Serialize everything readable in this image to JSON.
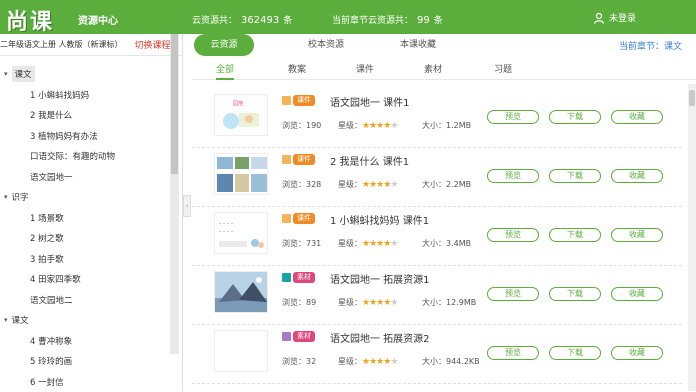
{
  "header": {
    "logo": "尚课",
    "section": "资源中心",
    "cloud_label": "云资源共：",
    "cloud_count": "362493",
    "cloud_unit": "条",
    "chapter_label": "当前章节云资源共：",
    "chapter_count": "99",
    "chapter_unit": "条",
    "login": "未登录"
  },
  "sidebar": {
    "book": "二年级语文上册 人教版（新课标）",
    "switch": "切换课程>",
    "tree": [
      {
        "label": "课文",
        "type": "unit",
        "active": true
      },
      {
        "label": "1 小蝌蚪找妈妈",
        "type": "lesson"
      },
      {
        "label": "2 我是什么",
        "type": "lesson"
      },
      {
        "label": "3 植物妈妈有办法",
        "type": "lesson"
      },
      {
        "label": "口语交际：有趣的动物",
        "type": "lesson"
      },
      {
        "label": "语文园地一",
        "type": "lesson"
      },
      {
        "label": "识字",
        "type": "unit"
      },
      {
        "label": "1 场景歌",
        "type": "lesson"
      },
      {
        "label": "2 树之歌",
        "type": "lesson"
      },
      {
        "label": "3 拍手歌",
        "type": "lesson"
      },
      {
        "label": "4 田家四季歌",
        "type": "lesson"
      },
      {
        "label": "语文园地二",
        "type": "lesson"
      },
      {
        "label": "课文",
        "type": "unit"
      },
      {
        "label": "4 曹冲称象",
        "type": "lesson"
      },
      {
        "label": "5 玲玲的画",
        "type": "lesson"
      },
      {
        "label": "6 一封信",
        "type": "lesson"
      }
    ]
  },
  "tabs": [
    "云资源",
    "校本资源",
    "本课收藏"
  ],
  "current_chapter": "当前章节：课文",
  "subtabs": [
    "全部",
    "教案",
    "课件",
    "素材",
    "习题"
  ],
  "labels": {
    "views": "浏览：",
    "rating": "星级：",
    "size": "大小：",
    "preview": "预览",
    "download": "下载",
    "favorite": "收藏"
  },
  "resources": [
    {
      "badge": "课件",
      "badge_color": "#f08a24",
      "square_color": "#f5b35b",
      "title": "语文园地一 课件1",
      "views": "190",
      "stars": 4,
      "size": "1.2MB"
    },
    {
      "badge": "课件",
      "badge_color": "#f08a24",
      "square_color": "#f5b35b",
      "title": "2 我是什么 课件1",
      "views": "328",
      "stars": 4,
      "size": "2.2MB"
    },
    {
      "badge": "课件",
      "badge_color": "#f08a24",
      "square_color": "#f5b35b",
      "title": "1 小蝌蚪找妈妈 课件1",
      "views": "731",
      "stars": 4,
      "size": "3.4MB"
    },
    {
      "badge": "素材",
      "badge_color": "#e0457b",
      "square_color": "#1aa3a3",
      "title": "语文园地一 拓展资源1",
      "views": "89",
      "stars": 4,
      "size": "12.9MB"
    },
    {
      "badge": "素材",
      "badge_color": "#e0457b",
      "square_color": "#a679c9",
      "title": "语文园地一 拓展资源2",
      "views": "32",
      "stars": 4,
      "size": "944.2KB"
    }
  ]
}
